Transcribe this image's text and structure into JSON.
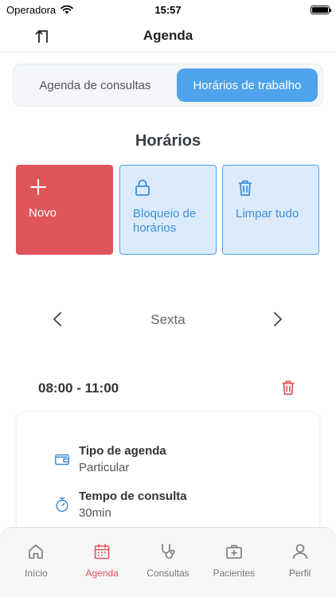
{
  "status_bar": {
    "carrier": "Operadora",
    "time": "15:57"
  },
  "header": {
    "title": "Agenda"
  },
  "segmented": {
    "tab_appointments": "Agenda de consultas",
    "tab_work_hours": "Horários de trabalho",
    "selected": "Horários de trabalho"
  },
  "section": {
    "title": "Horários"
  },
  "actions": {
    "new_label": "Novo",
    "block_label": "Bloqueio de horários",
    "clear_label": "Limpar tudo"
  },
  "day_selector": {
    "day": "Sexta"
  },
  "schedule": {
    "time_range": "08:00 - 11:00",
    "agenda_type_title": "Tipo de agenda",
    "agenda_type_value": "Particular",
    "consult_time_title": "Tempo de consulta",
    "consult_time_value": "30min"
  },
  "tab_bar": {
    "items": [
      {
        "label": "Início",
        "icon": "home-icon"
      },
      {
        "label": "Agenda",
        "icon": "calendar-icon"
      },
      {
        "label": "Consultas",
        "icon": "stethoscope-icon"
      },
      {
        "label": "Pacientes",
        "icon": "medical-kit-icon"
      },
      {
        "label": "Perfil",
        "icon": "person-icon"
      }
    ],
    "active": "Agenda"
  },
  "colors": {
    "accent_red": "#e05559",
    "accent_blue": "#4ea3ec",
    "light_blue": "#dcebfb"
  }
}
